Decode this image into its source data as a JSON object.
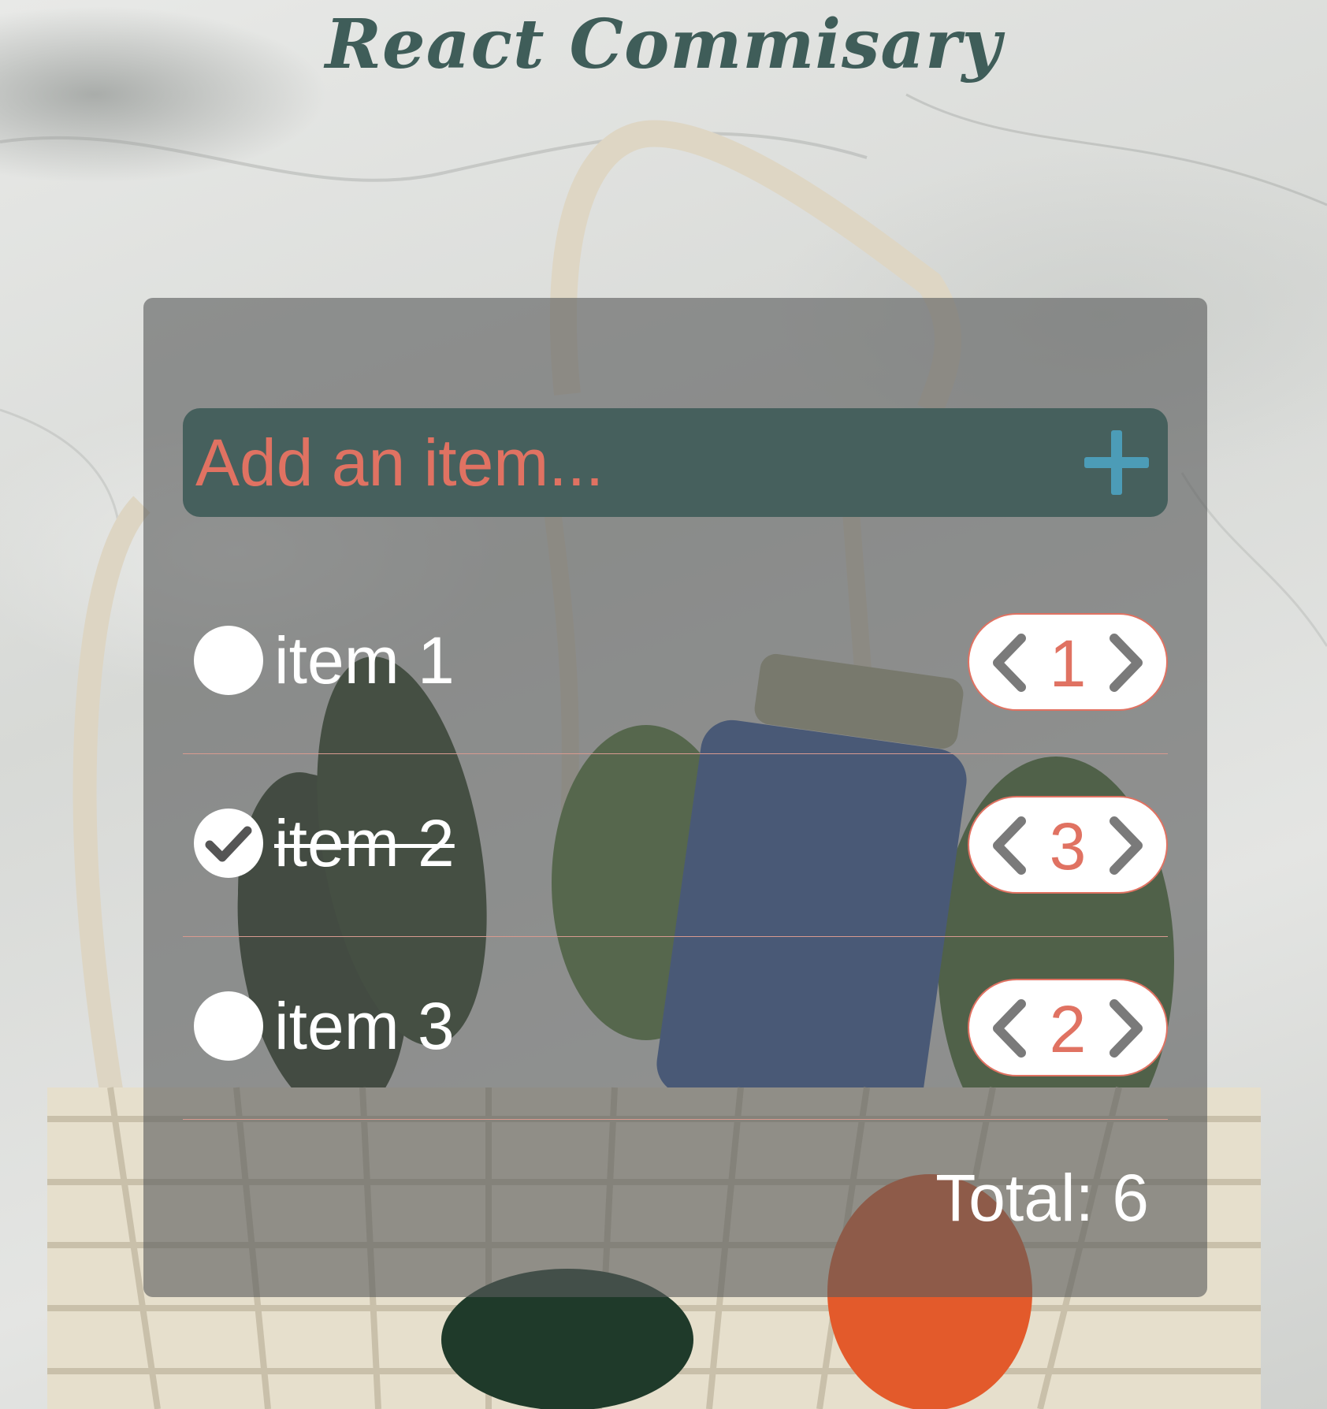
{
  "app": {
    "title": "React Commisary"
  },
  "add_item": {
    "placeholder": "Add an item...",
    "value": "",
    "add_icon": "plus-icon"
  },
  "items": [
    {
      "name": "item 1",
      "completed": false,
      "quantity": "1"
    },
    {
      "name": "item 2",
      "completed": true,
      "quantity": "3"
    },
    {
      "name": "item 3",
      "completed": false,
      "quantity": "2"
    }
  ],
  "total": {
    "text": "Total: 6"
  },
  "colors": {
    "title": "#3f5d59",
    "input_bar": "#46605d",
    "accent": "#e07262",
    "add_icon": "#4c9cb7",
    "arrow_icon": "#7a7a7a"
  }
}
